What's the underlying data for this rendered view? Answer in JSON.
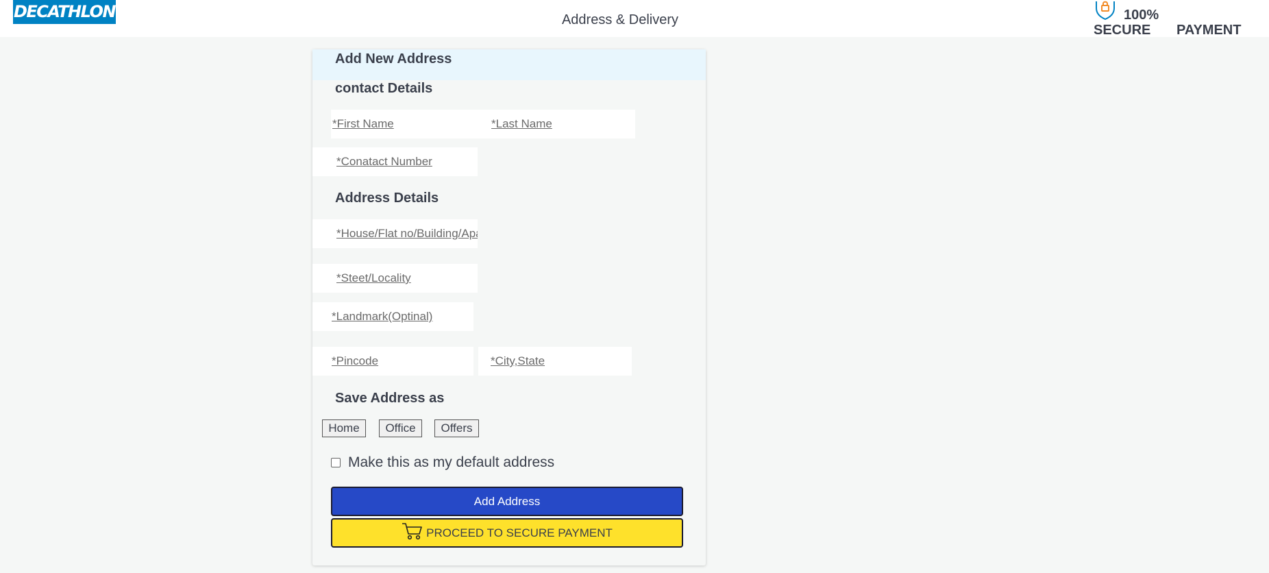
{
  "header": {
    "logo_text": "DECATHLON",
    "page_title": "Address & Delivery",
    "secure_percent": "100%",
    "secure_label": "SECURE",
    "payment_label": "PAYMENT"
  },
  "form": {
    "title": "Add New Address",
    "contact_section": "contact Details",
    "first_name_placeholder": "*First Name",
    "last_name_placeholder": "*Last Name",
    "contact_number_placeholder": "*Conatact Number",
    "address_section": "Address Details",
    "house_placeholder": "*House/Flat no/Building/Apartment",
    "street_placeholder": "*Steet/Locality",
    "landmark_placeholder": "*Landmark(Optinal)",
    "pincode_placeholder": "*Pincode",
    "city_state_placeholder": "*City,State",
    "save_as_section": "Save Address as",
    "save_as_options": [
      "Home",
      "Office",
      "Offers"
    ],
    "default_checkbox_label": "Make this as my default address",
    "default_checked": false,
    "add_address_label": "Add Address",
    "proceed_label": "PROCEED TO SECURE PAYMENT"
  },
  "colors": {
    "brand_blue": "#0082c3",
    "add_button": "#2649c7",
    "proceed_button": "#fee12b",
    "card_header": "#e8f6fd"
  }
}
